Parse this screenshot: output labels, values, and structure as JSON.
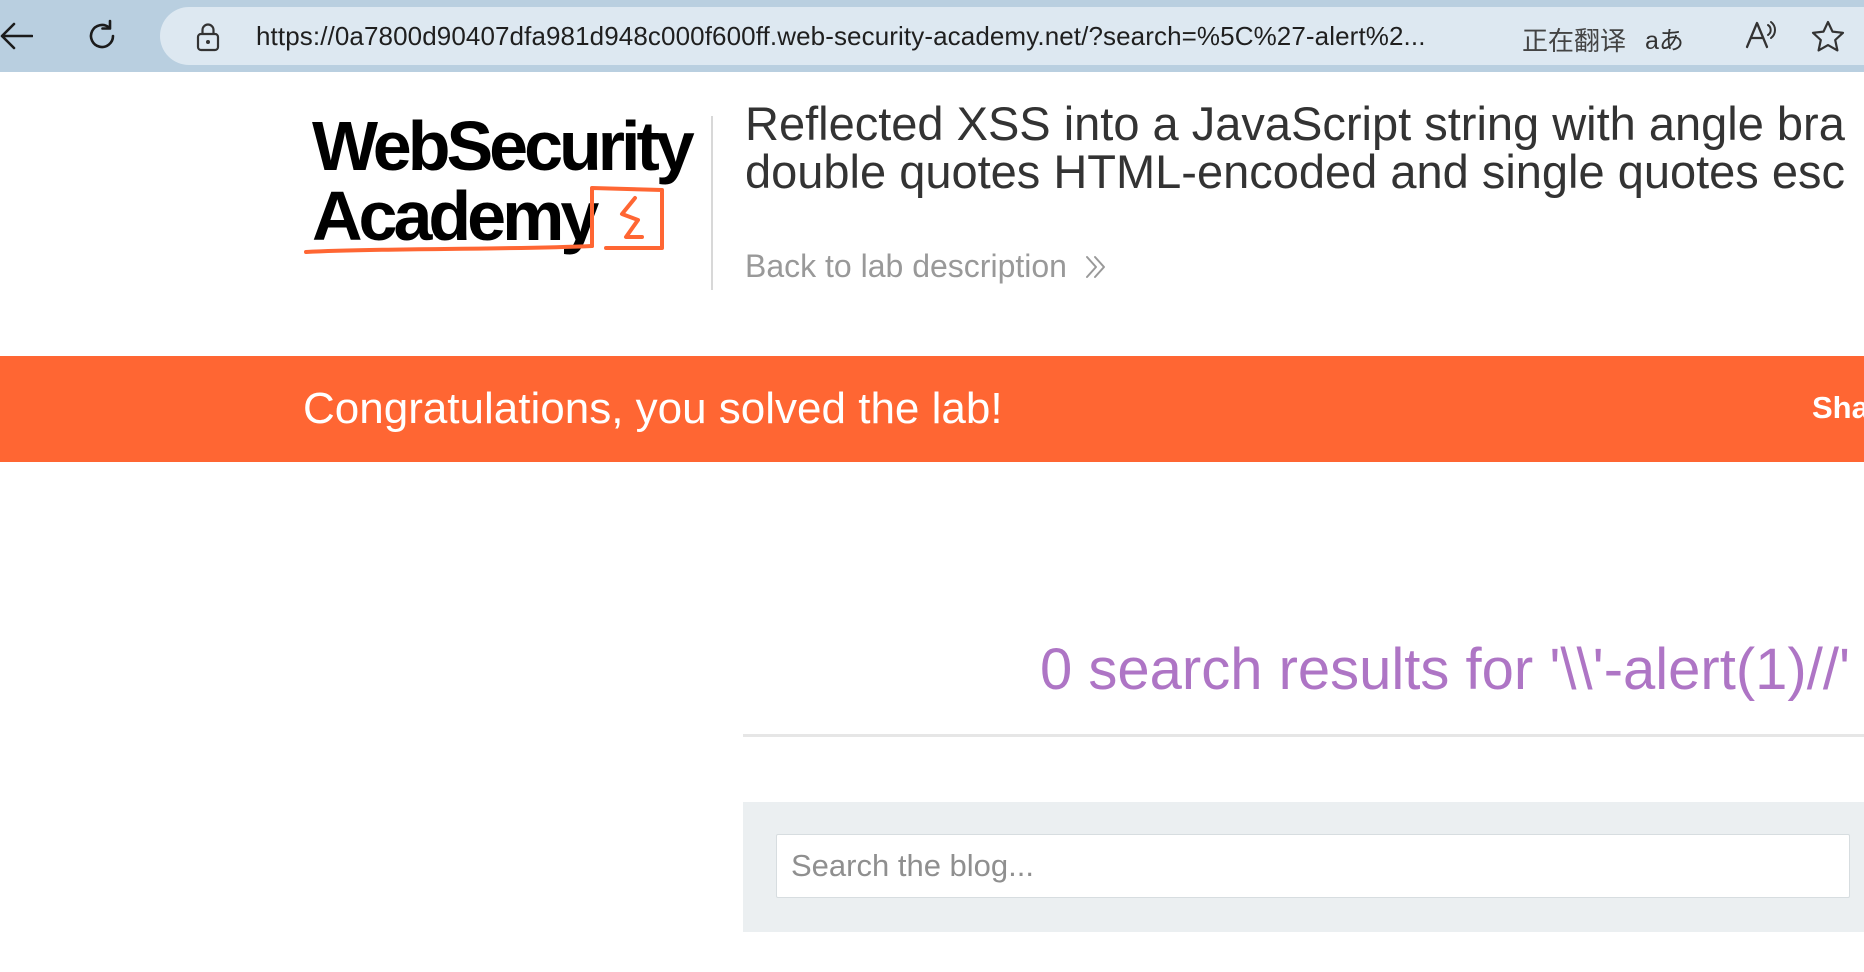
{
  "browser": {
    "url": "https://0a7800d90407dfa981d948c000f600ff.web-security-academy.net/?search=%5C%27-alert%2...",
    "translate_label": "正在翻译",
    "aa_label": "aあ"
  },
  "header": {
    "logo_line1": "WebSecurity",
    "logo_line2": "Academy",
    "title_line1": "Reflected XSS into a JavaScript string with angle bra",
    "title_line2": "double quotes HTML-encoded and single quotes esc",
    "back_link": "Back to lab description"
  },
  "banner": {
    "message": "Congratulations, you solved the lab!",
    "share": "Sha",
    "color": "#ff6633"
  },
  "results": {
    "heading": "0 search results for '\\\\'-alert(1)//'",
    "color": "#ae75c5"
  },
  "search": {
    "placeholder": "Search the blog...",
    "value": ""
  }
}
